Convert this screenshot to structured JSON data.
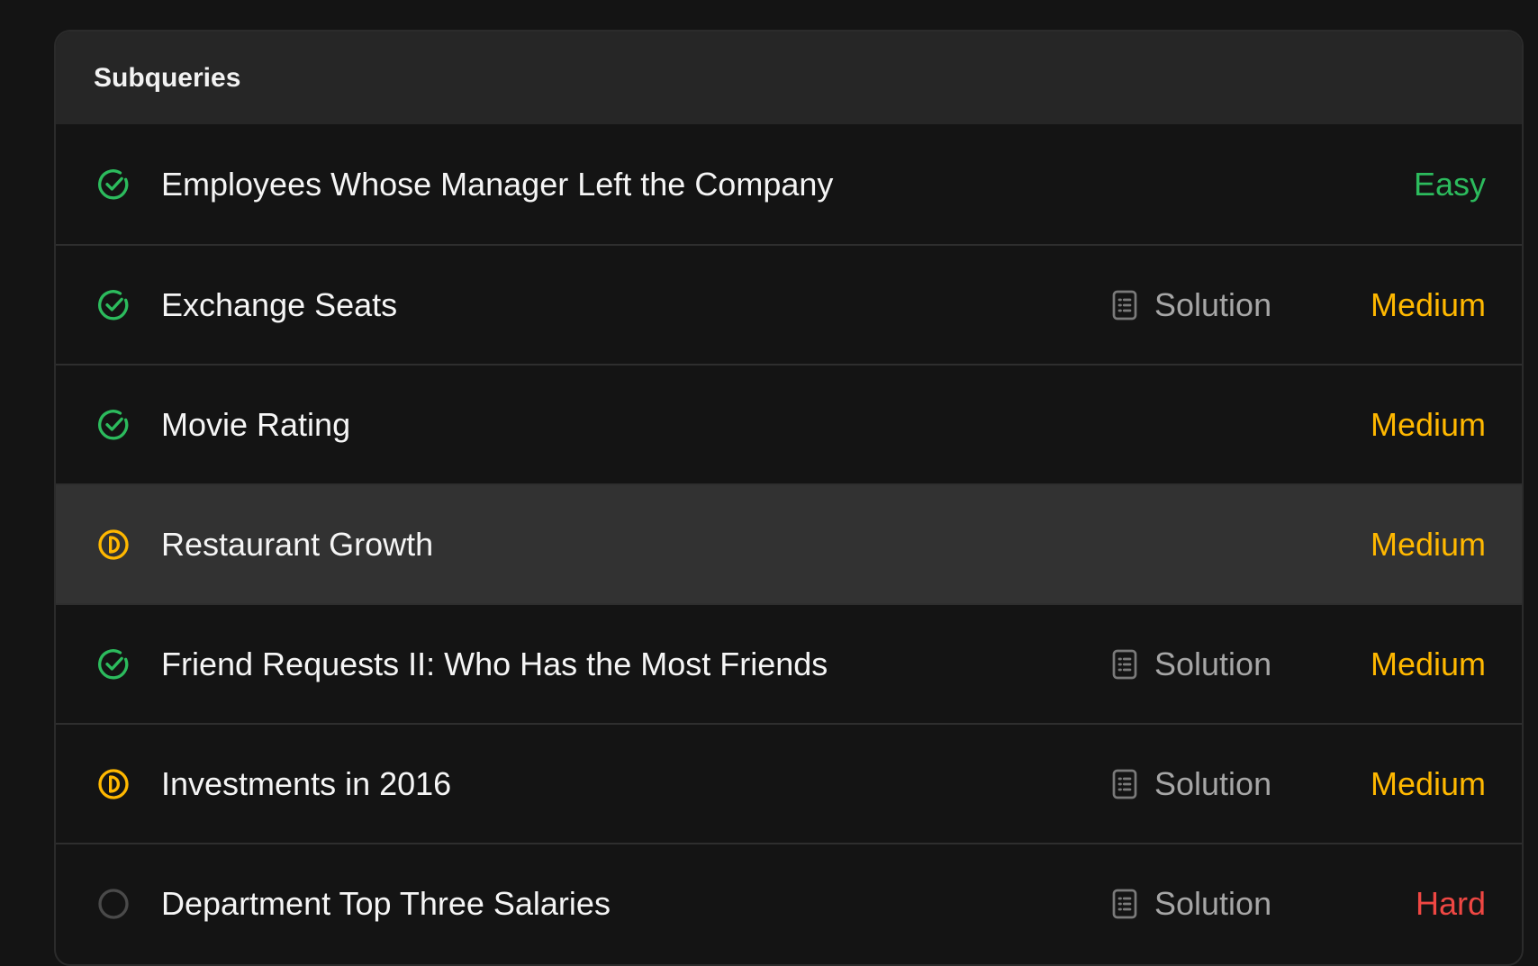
{
  "panel": {
    "title": "Subqueries"
  },
  "colors": {
    "easy": "#2cbb5d",
    "medium": "#ffb800",
    "hard": "#ef4743",
    "solved": "#2cbb5d",
    "attempted": "#ffb800",
    "todo": "#4a4a4a"
  },
  "rows": [
    {
      "title": "Employees Whose Manager Left the Company",
      "status": "solved",
      "status_icon": "check-circle-icon",
      "solution": "",
      "difficulty": "Easy",
      "level": "easy"
    },
    {
      "title": "Exchange Seats",
      "status": "solved",
      "status_icon": "check-circle-icon",
      "solution": "Solution",
      "difficulty": "Medium",
      "level": "medium"
    },
    {
      "title": "Movie Rating",
      "status": "solved",
      "status_icon": "check-circle-icon",
      "solution": "",
      "difficulty": "Medium",
      "level": "medium"
    },
    {
      "title": "Restaurant Growth",
      "status": "attempted",
      "status_icon": "half-circle-icon",
      "solution": "",
      "difficulty": "Medium",
      "level": "medium",
      "highlighted": true
    },
    {
      "title": "Friend Requests II: Who Has the Most Friends",
      "status": "solved",
      "status_icon": "check-circle-icon",
      "solution": "Solution",
      "difficulty": "Medium",
      "level": "medium"
    },
    {
      "title": "Investments in 2016",
      "status": "attempted",
      "status_icon": "half-circle-icon",
      "solution": "Solution",
      "difficulty": "Medium",
      "level": "medium"
    },
    {
      "title": "Department Top Three Salaries",
      "status": "todo",
      "status_icon": "empty-circle-icon",
      "solution": "Solution",
      "difficulty": "Hard",
      "level": "hard"
    }
  ]
}
